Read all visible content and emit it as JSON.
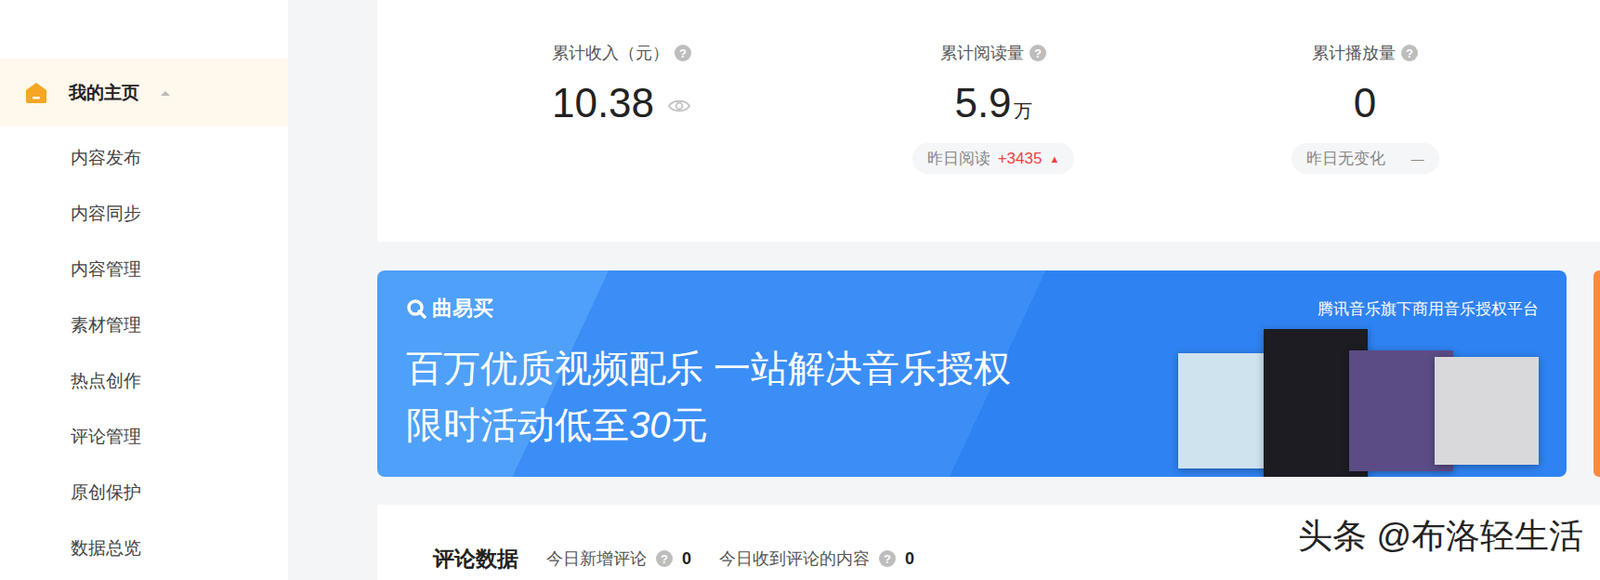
{
  "sidebar": {
    "items": [
      {
        "label": "我的主页",
        "selected": true,
        "expanded": true,
        "kind": "group"
      },
      {
        "label": "内容发布",
        "selected": false,
        "expanded": false,
        "kind": "link"
      },
      {
        "label": "内容同步",
        "selected": false,
        "expanded": false,
        "kind": "link"
      },
      {
        "label": "内容管理",
        "selected": false,
        "expanded": false,
        "kind": "link"
      },
      {
        "label": "素材管理",
        "selected": false,
        "expanded": false,
        "kind": "link"
      },
      {
        "label": "热点创作",
        "selected": false,
        "expanded": false,
        "kind": "link"
      },
      {
        "label": "评论管理",
        "selected": false,
        "expanded": false,
        "kind": "link"
      },
      {
        "label": "原创保护",
        "selected": false,
        "expanded": false,
        "kind": "link"
      },
      {
        "label": "数据总览",
        "selected": false,
        "expanded": false,
        "kind": "link"
      }
    ]
  },
  "stats": [
    {
      "label": "累计收入（元）",
      "help": "?",
      "value": "10.38",
      "unit": "",
      "kind": "hidden-toggle"
    },
    {
      "label": "累计阅读量",
      "help": "?",
      "value": "5.9",
      "unit": "万",
      "kind": "badge",
      "badge": {
        "text": "昨日阅读",
        "delta": "+3435",
        "mark": "▲",
        "trend": "up"
      }
    },
    {
      "label": "累计播放量",
      "help": "?",
      "value": "0",
      "unit": "",
      "kind": "badge",
      "badge": {
        "text": "昨日无变化",
        "delta": "",
        "mark": "—",
        "trend": "none"
      }
    }
  ],
  "banner": {
    "brand": "曲易买",
    "headline": "百万优质视频配乐 一站解决音乐授权",
    "subline": "限时活动低至",
    "price": "30",
    "currency": "元",
    "tagline": "腾讯音乐旗下商用音乐授权平台"
  },
  "comments": {
    "title": "评论数据",
    "metrics": [
      {
        "label": "今日新增评论",
        "help": "?",
        "value": "0"
      },
      {
        "label": "今日收到评论的内容",
        "help": "?",
        "value": "0"
      }
    ]
  },
  "watermark": "头条 @布洛轻生活"
}
